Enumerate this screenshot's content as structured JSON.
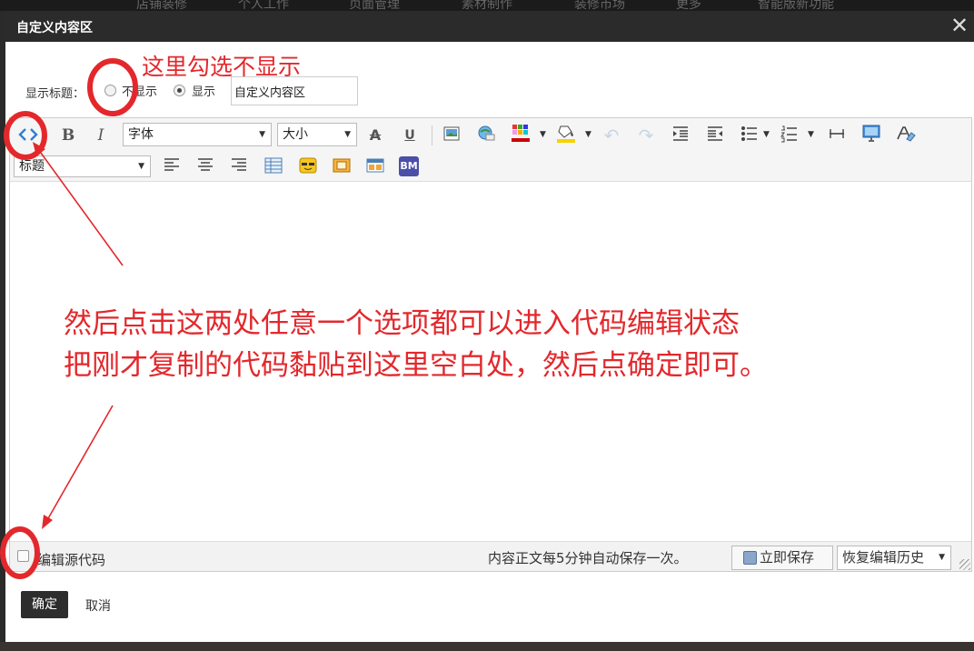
{
  "background": {
    "nav_items": [
      "店铺装修",
      "个人工作",
      "页面管理",
      "素材制作",
      "装修市场",
      "更多",
      "智能版新功能"
    ]
  },
  "dialog": {
    "title": "自定义内容区",
    "close_glyph": "✕"
  },
  "title_row": {
    "label": "显示标题：",
    "option_hide": "不显示",
    "option_show": "显示",
    "selected": "显示",
    "input_value": "自定义内容区"
  },
  "toolbar": {
    "font_select": "字体",
    "size_select": "大小",
    "heading_select": "标题",
    "bold": "B",
    "italic": "I",
    "strike": "A",
    "underline": "U",
    "bm": "BM"
  },
  "statusbar": {
    "source_label": "编辑源代码",
    "autosave_text": "内容正文每5分钟自动保存一次。",
    "save_now": "立即保存",
    "restore_history": "恢复编辑历史"
  },
  "footer": {
    "ok": "确定",
    "cancel": "取消"
  },
  "annotations": {
    "hint_title": "这里勾选不显示",
    "hint_line1": "然后点击这两处任意一个选项都可以进入代码编辑状态",
    "hint_line2": "把刚才复制的代码黏贴到这里空白处，然后点确定即可。"
  },
  "colors": {
    "annotation_red": "#e3282c",
    "titlebar": "#2b2b2b",
    "ok_button": "#2d2d2d"
  }
}
